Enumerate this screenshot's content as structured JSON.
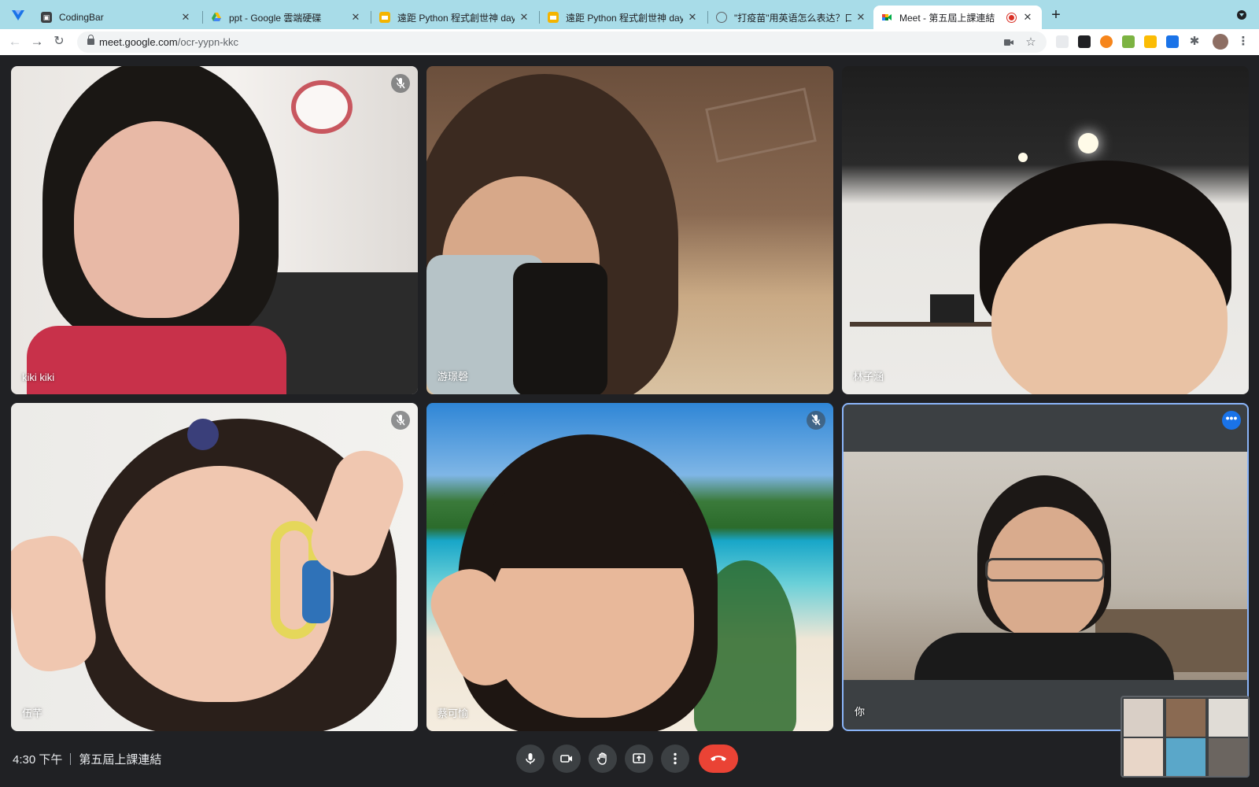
{
  "browser": {
    "tabs": [
      {
        "title": "CodingBar",
        "active": false
      },
      {
        "title": "ppt - Google 雲端硬碟",
        "active": false
      },
      {
        "title": "遠距 Python 程式創世神 day8 -",
        "active": false
      },
      {
        "title": "遠距 Python 程式創世神 day9 -",
        "active": false
      },
      {
        "title": "\"打疫苗\"用英语怎么表达？口语",
        "active": false
      },
      {
        "title": "Meet - 第五屆上課連結",
        "active": true
      }
    ],
    "url_host": "meet.google.com",
    "url_path": "/ocr-yypn-kkc"
  },
  "meet": {
    "participants": [
      {
        "name": "kiki kiki",
        "muted": true
      },
      {
        "name": "游璟磬",
        "muted": false
      },
      {
        "name": "林子涵",
        "muted": false
      },
      {
        "name": "伍芊",
        "muted": true
      },
      {
        "name": "蔡可愉",
        "muted": true
      },
      {
        "name": "你",
        "muted": false
      }
    ],
    "time": "4:30 下午",
    "meeting_title": "第五屆上課連結"
  },
  "colors": {
    "tab_strip": "#a8dce8",
    "meet_background": "#202124",
    "control_button": "#3c4043",
    "hangup_red": "#ea4335",
    "active_speaker_border": "#8ab4f8",
    "more_button_blue": "#1a73e8"
  },
  "icons": {
    "controls": [
      "microphone-icon",
      "camera-icon",
      "raise-hand-icon",
      "present-screen-icon",
      "more-options-icon",
      "hang-up-icon"
    ]
  }
}
